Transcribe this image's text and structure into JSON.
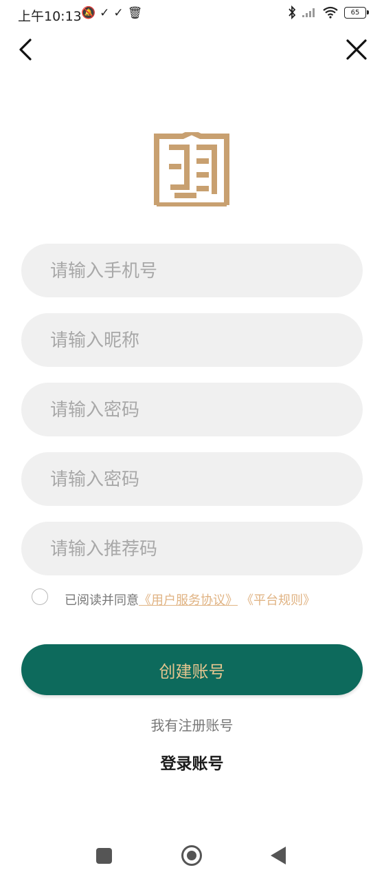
{
  "status_bar": {
    "time": "上午10:13",
    "left_icons": [
      "mute-icon",
      "check-icon",
      "check-icon",
      "trash-icon"
    ],
    "battery": "65"
  },
  "nav": {
    "back_icon": "back-arrow-icon",
    "close_icon": "close-icon"
  },
  "form": {
    "phone_placeholder": "请输入手机号",
    "nickname_placeholder": "请输入昵称",
    "password_placeholder": "请输入密码",
    "confirm_password_placeholder": "请输入密码",
    "referral_placeholder": "请输入推荐码"
  },
  "agreement": {
    "prefix": "已阅读并同意",
    "user_agreement": "《用户服务协议》",
    "platform_rules": "《平台规则》"
  },
  "actions": {
    "create_label": "创建账号",
    "have_account": "我有注册账号",
    "login_label": "登录账号"
  },
  "colors": {
    "accent_green": "#0d6a5c",
    "gold": "#c8a070",
    "link": "#e0b383"
  }
}
